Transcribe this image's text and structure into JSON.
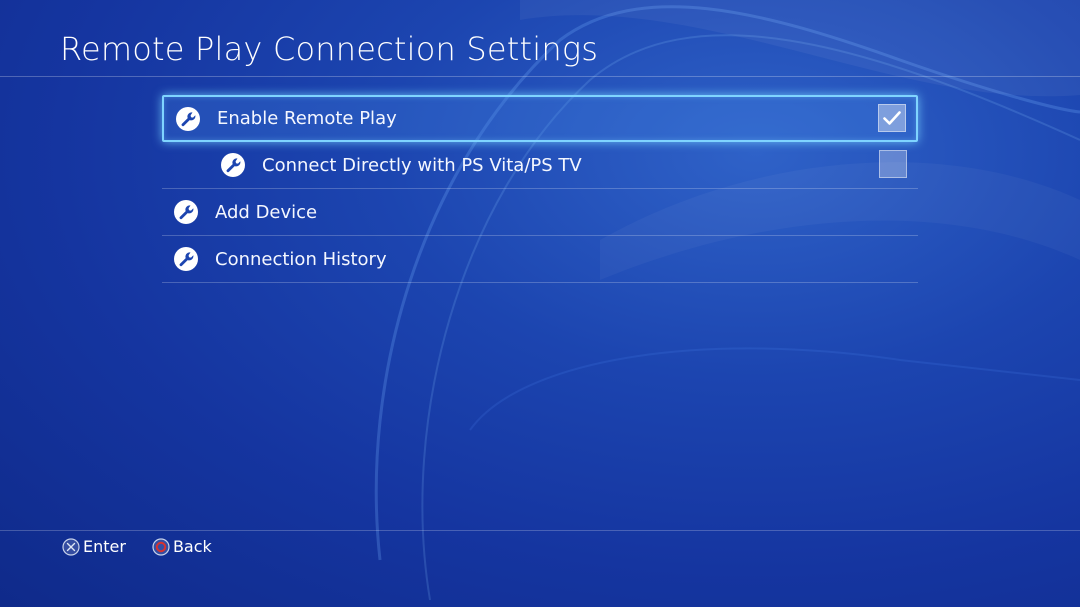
{
  "page": {
    "title": "Remote Play Connection Settings"
  },
  "colors": {
    "background": "#1c45b0",
    "selection_border": "#7fd4ff",
    "back_button": "#d8312e"
  },
  "menu": {
    "items": [
      {
        "label": "Enable Remote Play",
        "icon": "wrench-icon",
        "checked": true,
        "selected": true
      },
      {
        "label": "Connect Directly with PS Vita/PS TV",
        "icon": "wrench-icon",
        "checked": false,
        "selected": false
      },
      {
        "label": "Add Device",
        "icon": "wrench-icon"
      },
      {
        "label": "Connection History",
        "icon": "wrench-icon"
      }
    ]
  },
  "footer": {
    "enter_label": "Enter",
    "enter_icon": "cross-button-icon",
    "back_label": "Back",
    "back_icon": "circle-button-icon"
  }
}
